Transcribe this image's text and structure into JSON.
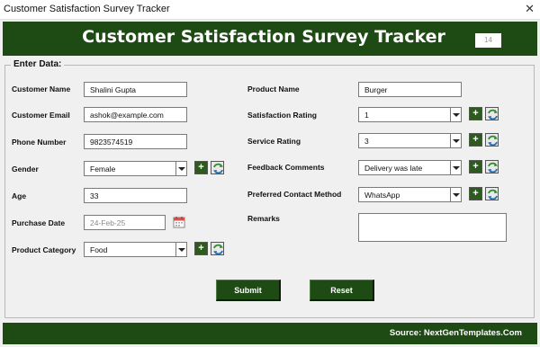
{
  "window": {
    "title": "Customer Satisfaction Survey Tracker",
    "close_glyph": "✕"
  },
  "header": {
    "title": "Customer Satisfaction Survey Tracker",
    "id_value": "14"
  },
  "form": {
    "legend": "Enter Data:",
    "customer_name": {
      "label": "Customer Name",
      "value": "Shalini Gupta"
    },
    "customer_email": {
      "label": "Customer Email",
      "value": "ashok@example.com"
    },
    "phone_number": {
      "label": "Phone Number",
      "value": "9823574519"
    },
    "gender": {
      "label": "Gender",
      "value": "Female"
    },
    "age": {
      "label": "Age",
      "value": "33"
    },
    "purchase_date": {
      "label": "Purchase Date",
      "value": "24-Feb-25"
    },
    "product_category": {
      "label": "Product Category",
      "value": "Food"
    },
    "product_name": {
      "label": "Product Name",
      "value": "Burger"
    },
    "satisfaction_rating": {
      "label": "Satisfaction Rating",
      "value": "1"
    },
    "service_rating": {
      "label": "Service Rating",
      "value": "3"
    },
    "feedback_comments": {
      "label": "Feedback Comments",
      "value": "Delivery was late"
    },
    "preferred_contact": {
      "label": "Preferred Contact Method",
      "value": "WhatsApp"
    },
    "remarks": {
      "label": "Remarks",
      "value": ""
    },
    "add_glyph": "+"
  },
  "buttons": {
    "submit": "Submit",
    "reset": "Reset"
  },
  "footer": {
    "source": "Source: NextGenTemplates.Com"
  },
  "colors": {
    "header_bg": "#1e4a14",
    "add_button_bg": "#2d5a1f",
    "refresh_green": "#2e8b2e",
    "refresh_blue": "#2a6fb5"
  },
  "icons": {
    "close": "close-icon",
    "add": "plus-icon",
    "refresh": "refresh-icon",
    "calendar": "calendar-icon",
    "dropdown": "chevron-down-icon"
  }
}
